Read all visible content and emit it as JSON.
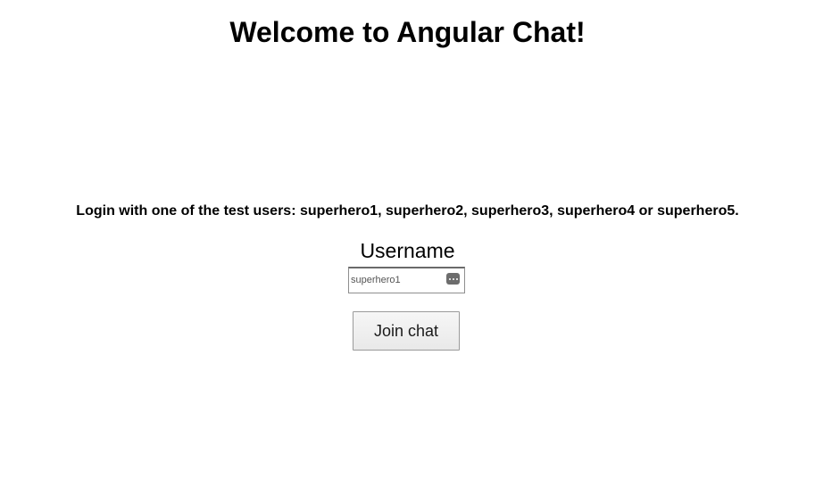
{
  "header": {
    "title": "Welcome to Angular Chat!"
  },
  "login": {
    "instructions": "Login with one of the test users: superhero1, superhero2, superhero3, superhero4 or superhero5.",
    "username_label": "Username",
    "username_value": "superhero1",
    "autofill_icon": "more-dots-icon",
    "join_button_label": "Join chat"
  }
}
